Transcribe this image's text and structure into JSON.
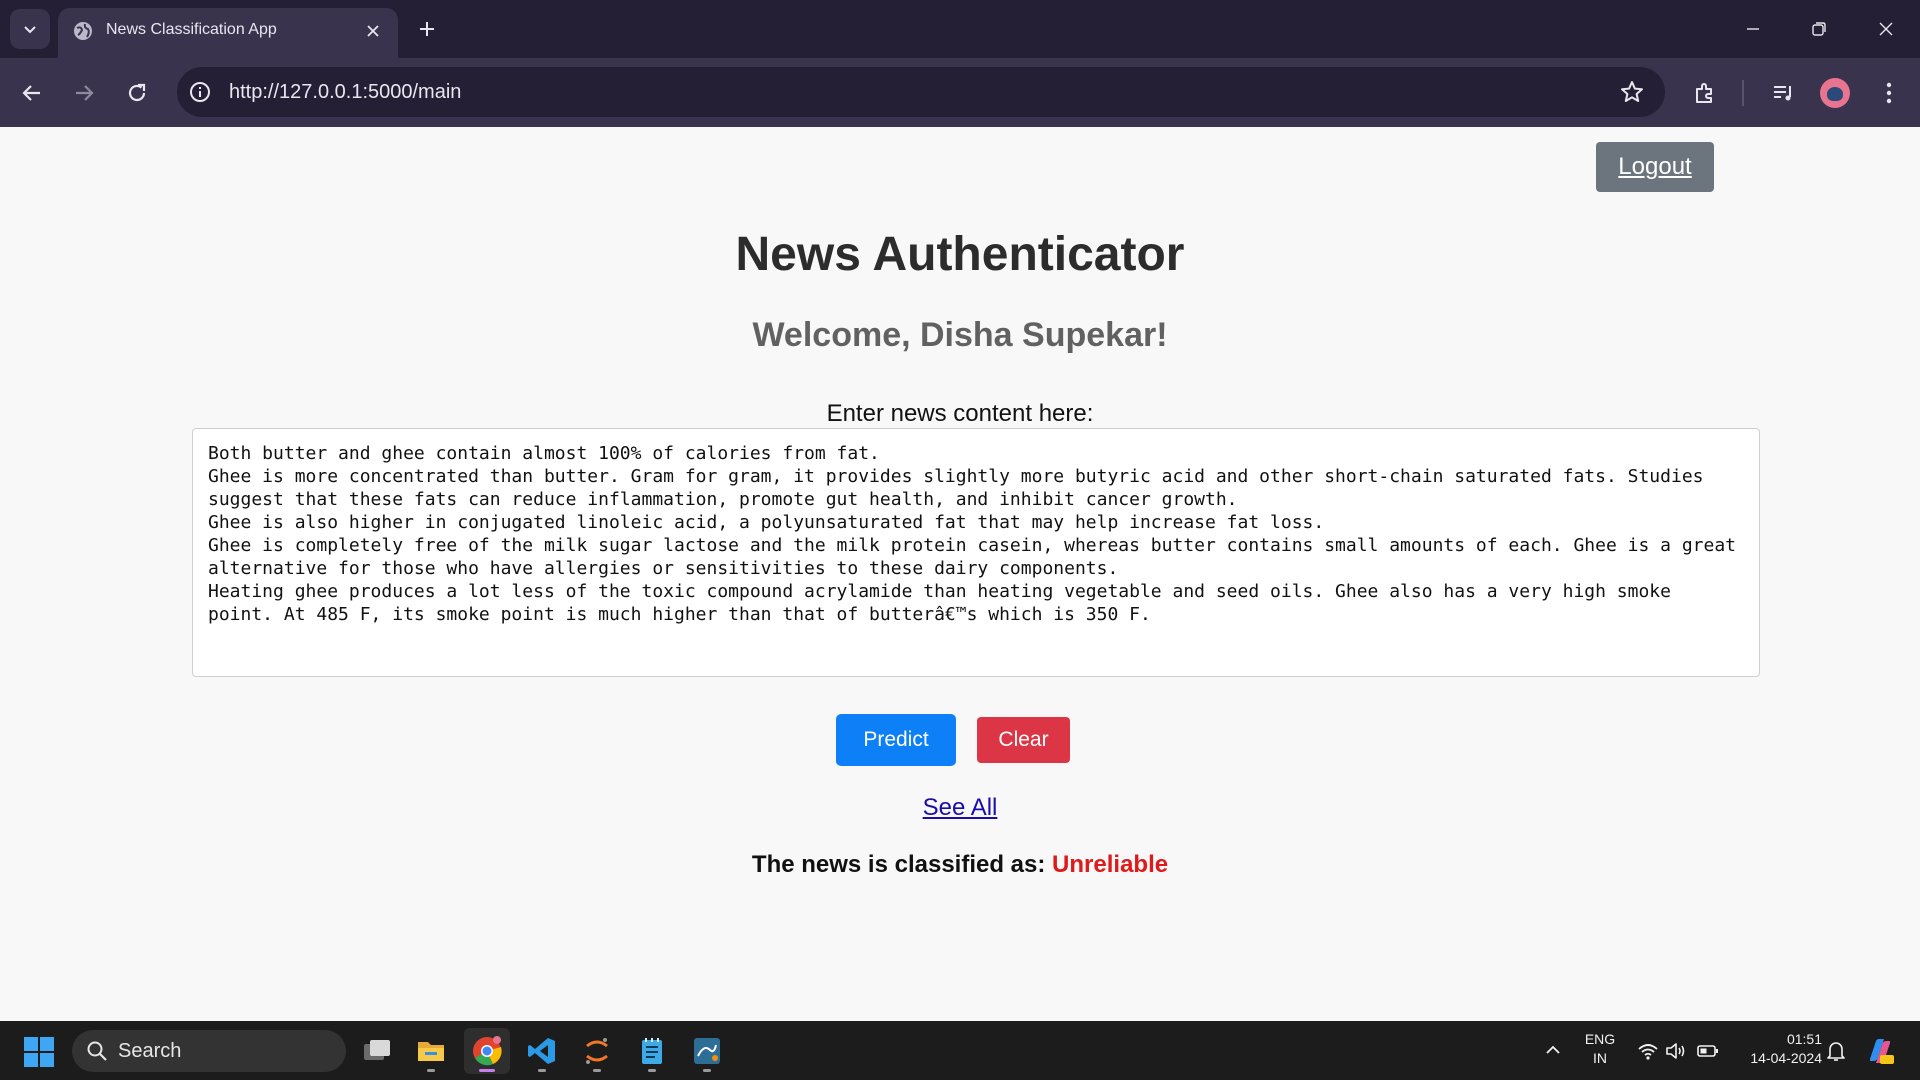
{
  "browser": {
    "tab_title": "News Classification App",
    "url": "http://127.0.0.1:5000/main"
  },
  "page": {
    "logout_label": "Logout",
    "title": "News Authenticator",
    "welcome": "Welcome, Disha Supekar!",
    "input_label": "Enter news content here:",
    "news_text": "Both butter and ghee contain almost 100% of calories from fat.\nGhee is more concentrated than butter. Gram for gram, it provides slightly more butyric acid and other short-chain saturated fats. Studies suggest that these fats can reduce inflammation, promote gut health, and inhibit cancer growth.\nGhee is also higher in conjugated linoleic acid, a polyunsaturated fat that may help increase fat loss.\nGhee is completely free of the milk sugar lactose and the milk protein casein, whereas butter contains small amounts of each. Ghee is a great alternative for those who have allergies or sensitivities to these dairy components.\nHeating ghee produces a lot less of the toxic compound acrylamide than heating vegetable and seed oils. Ghee also has a very high smoke point. At 485 F, its smoke point is much higher than that of butterâ€™s which is 350 F.",
    "predict_label": "Predict",
    "clear_label": "Clear",
    "see_all_label": "See All",
    "result_prefix": "The news is classified as:",
    "result_value": "Unreliable"
  },
  "taskbar": {
    "search_label": "Search",
    "lang_line1": "ENG",
    "lang_line2": "IN",
    "time": "01:51",
    "date": "14-04-2024"
  },
  "colors": {
    "chrome_dark": "#251f35",
    "chrome_toolbar": "#3a334d",
    "predict_button": "#0d7ff7",
    "clear_button": "#dc3545",
    "logout_button": "#6c757d",
    "result_value": "#e0191a"
  },
  "icons": [
    "tab-search-icon",
    "globe-icon",
    "close-icon",
    "plus-icon",
    "minimize-icon",
    "restore-icon",
    "window-close-icon",
    "back-arrow-icon",
    "forward-arrow-icon",
    "reload-icon",
    "info-icon",
    "star-icon",
    "extensions-icon",
    "media-controls-icon",
    "more-vert-icon",
    "windows-start-icon",
    "search-icon",
    "task-view-icon",
    "file-explorer-icon",
    "chrome-icon",
    "vscode-icon",
    "jupyter-icon",
    "notepad-icon",
    "mysql-workbench-icon",
    "chevron-up-icon",
    "wifi-icon",
    "volume-icon",
    "battery-icon",
    "bell-icon",
    "copilot-icon"
  ]
}
